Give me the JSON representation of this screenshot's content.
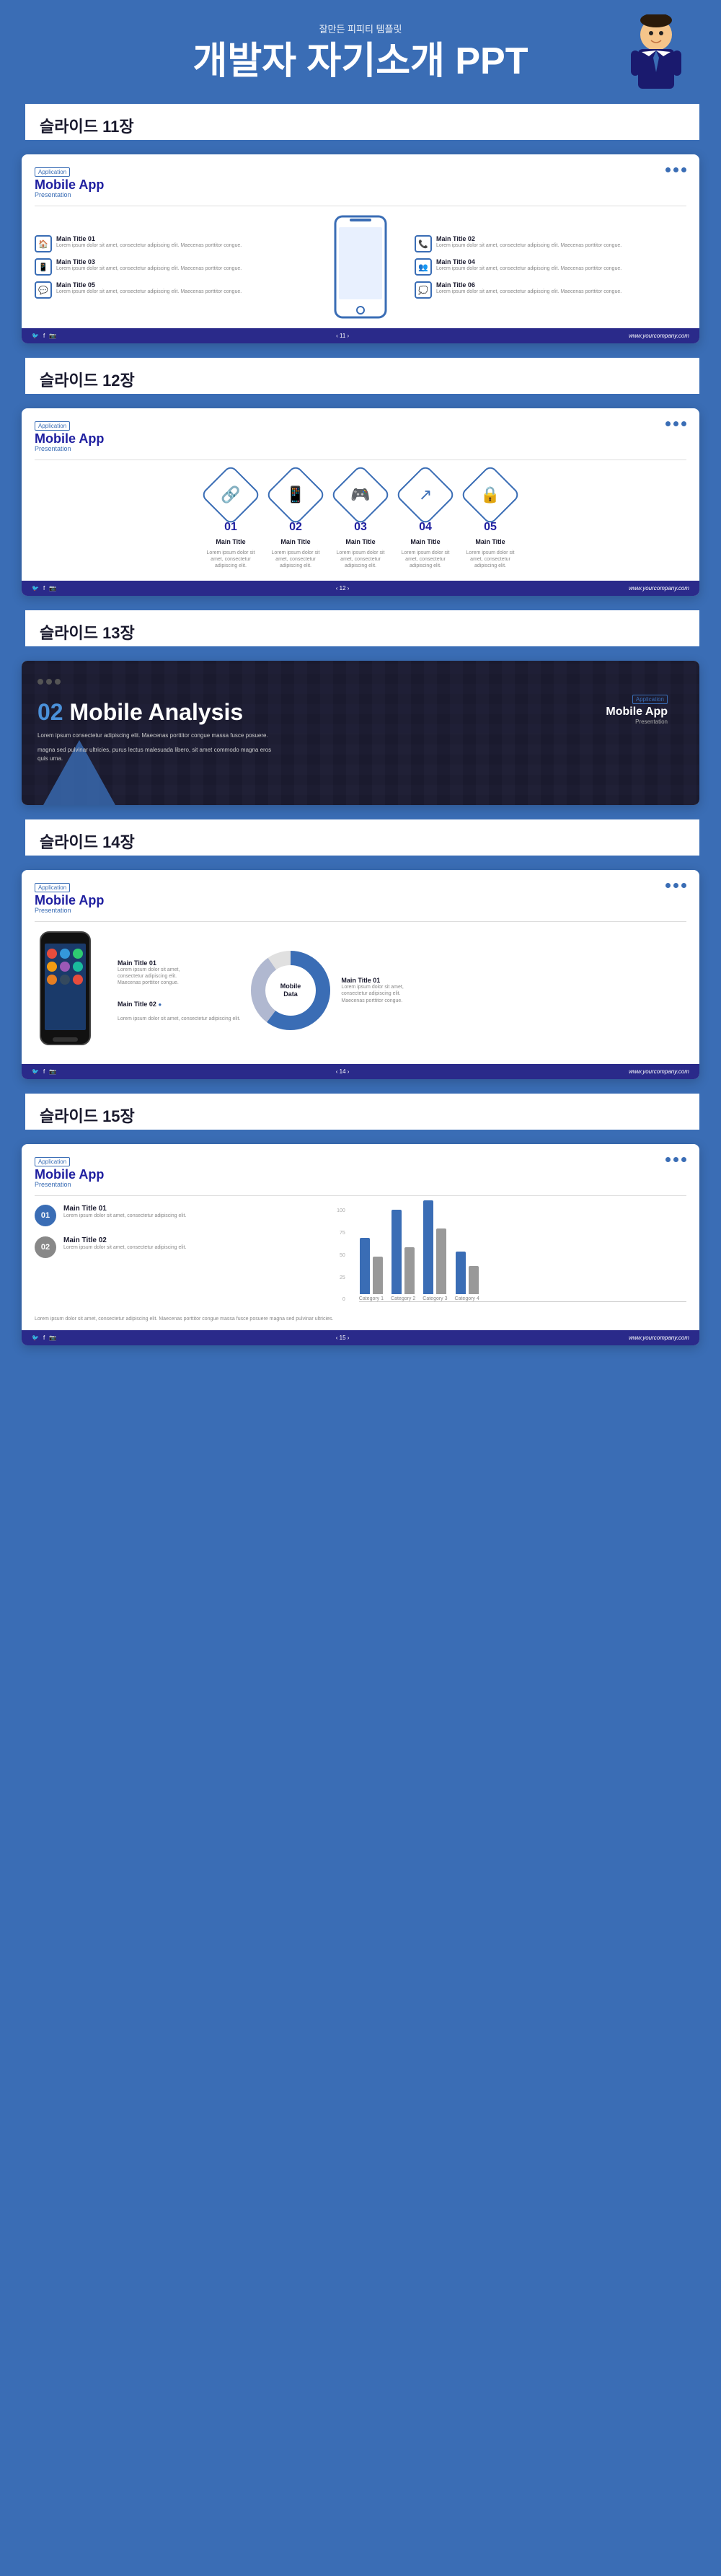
{
  "header": {
    "subtitle": "잘만든 피피티 템플릿",
    "main_title": "개발자 자기소개 PPT"
  },
  "slides": [
    {
      "id": "slide11",
      "label": "슬라이드 11장",
      "brand": {
        "app_label": "Application",
        "app_name": "Mobile App",
        "app_sub": "Presentation"
      },
      "features_left": [
        {
          "icon": "🏠",
          "title": "Main Title 01",
          "desc": "Lorem ipsum dolor sit amet, consectetur adipiscing elit. Maecenas porttitor congue."
        },
        {
          "icon": "📱",
          "title": "Main Title 03",
          "desc": "Lorem ipsum dolor sit amet, consectetur adipiscing elit. Maecenas porttitor congue."
        },
        {
          "icon": "💬",
          "title": "Main Title 05",
          "desc": "Lorem ipsum dolor sit amet, consectetur adipiscing elit. Maecenas porttitor congue."
        }
      ],
      "features_right": [
        {
          "icon": "📞",
          "title": "Main Title 02",
          "desc": "Lorem ipsum dolor sit amet, consectetur adipiscing elit. Maecenas porttitor congue."
        },
        {
          "icon": "👥",
          "title": "Main Title 04",
          "desc": "Lorem ipsum dolor sit amet, consectetur adipiscing elit. Maecenas porttitor congue."
        },
        {
          "icon": "💭",
          "title": "Main Title 06",
          "desc": "Lorem ipsum dolor sit amet, consectetur adipiscing elit. Maecenas porttitor congue."
        }
      ],
      "footer": {
        "page": "‹ 11 ›",
        "url": "www.yourcompany.com"
      }
    },
    {
      "id": "slide12",
      "label": "슬라이드 12장",
      "brand": {
        "app_label": "Application",
        "app_name": "Mobile App",
        "app_sub": "Presentation"
      },
      "items": [
        {
          "num": "01",
          "title": "Main Title",
          "icon": "🔗",
          "desc": "Lorem ipsum dolor sit amet, consectetur adipiscing elit."
        },
        {
          "num": "02",
          "title": "Main Title",
          "icon": "📱",
          "desc": "Lorem ipsum dolor sit amet, consectetur adipiscing elit."
        },
        {
          "num": "03",
          "title": "Main Title",
          "icon": "🎮",
          "desc": "Lorem ipsum dolor sit amet, consectetur adipiscing elit."
        },
        {
          "num": "04",
          "title": "Main Title",
          "icon": "↗",
          "desc": "Lorem ipsum dolor sit amet, consectetur adipiscing elit."
        },
        {
          "num": "05",
          "title": "Main Title",
          "icon": "🔒",
          "desc": "Lorem ipsum dolor sit amet, consectetur adipiscing elit."
        }
      ],
      "footer": {
        "page": "‹ 12 ›",
        "url": "www.yourcompany.com"
      }
    },
    {
      "id": "slide13",
      "label": "슬라이드 13장",
      "brand": {
        "app_label": "Application",
        "app_name": "Mobile App",
        "app_sub": "Presentation"
      },
      "num": "02",
      "main_text": "Mobile Analysis",
      "desc1": "Lorem ipsum consectetur adipiscing elit. Maecenas porttitor congue massa fusce posuere.",
      "desc2": "magna sed pulvinar ultricies, purus lectus malesuada libero, sit amet commodo magna eros quis urna."
    },
    {
      "id": "slide14",
      "label": "슬라이드 14장",
      "brand": {
        "app_label": "Application",
        "app_name": "Mobile App",
        "app_sub": "Presentation"
      },
      "main_title2": "Main Title 02",
      "main_title2_desc": "Lorem ipsum dolor sit amet, consectetur adipiscing elit.",
      "donut_label": "Mobile\nData",
      "label1": "Main Title 01",
      "label1_desc": "Lorem ipsum dolor sit amet, consectetur adipiscing elit. Maecenas porttitor congue.",
      "label2": "Main Title 01",
      "label2_desc": "Lorem ipsum dolor sit amet, consectetur adipiscing elit. Maecenas porttitor congue.",
      "footer": {
        "page": "‹ 14 ›",
        "url": "www.yourcompany.com"
      }
    },
    {
      "id": "slide15",
      "label": "슬라이드 15장",
      "brand": {
        "app_label": "Application",
        "app_name": "Mobile App",
        "app_sub": "Presentation"
      },
      "items": [
        {
          "num": "01",
          "title": "Main Title 01",
          "desc": "Lorem ipsum dolor sit amet, consectetur adipiscing elit.",
          "color": "blue"
        },
        {
          "num": "02",
          "title": "Main Title 02",
          "desc": "Lorem ipsum dolor sit amet, consectetur adipiscing elit.",
          "color": "gray"
        }
      ],
      "footer_text": "Lorem ipsum dolor sit amet, consectetur adipiscing elit. Maecenas porttitor congue massa fusce posuere magna sed pulvinar ultricies.",
      "chart": {
        "categories": [
          "Category 1",
          "Category 2",
          "Category 3",
          "Category 4"
        ],
        "series": [
          {
            "name": "Blue",
            "values": [
              60,
              90,
              110,
              45
            ]
          },
          {
            "name": "Gray",
            "values": [
              40,
              50,
              70,
              30
            ]
          }
        ],
        "y_labels": [
          "100",
          "75",
          "50",
          "25",
          "0"
        ]
      },
      "footer": {
        "page": "‹ 15 ›",
        "url": "www.yourcompany.com"
      }
    }
  ]
}
